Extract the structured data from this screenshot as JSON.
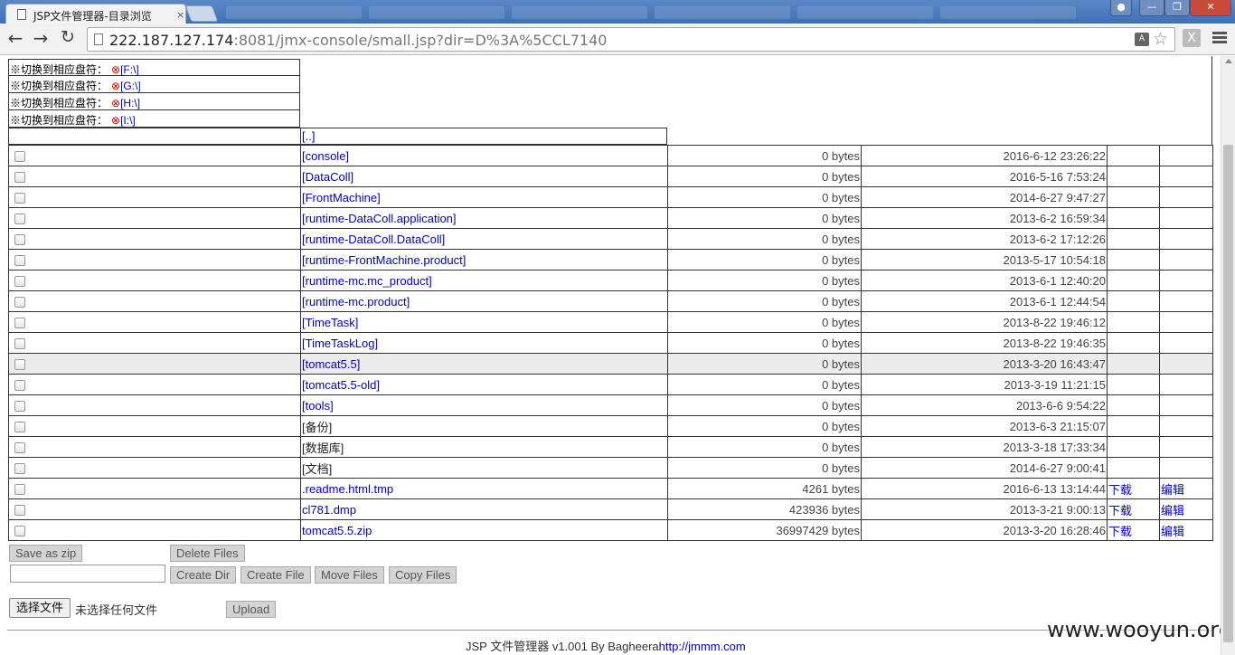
{
  "browser": {
    "tab_title": "JSP文件管理器-目录浏览",
    "tab_close": "×",
    "url_host": "222.187.127.174",
    "url_rest": ":8081/jmx-console/small.jsp?dir=D%3A%5CCL7140",
    "ext_label": "X"
  },
  "drives": [
    {
      "label": "※切换到相应盘符：",
      "link": "[F:\\]"
    },
    {
      "label": "※切换到相应盘符：",
      "link": "[G:\\]"
    },
    {
      "label": "※切换到相应盘符：",
      "link": "[H:\\]"
    },
    {
      "label": "※切换到相应盘符：",
      "link": "[I:\\]"
    }
  ],
  "parent_link": "[..]",
  "files": [
    {
      "name": "[console]",
      "size": "0 bytes",
      "date": "2016-6-12 23:26:22",
      "dl": "",
      "edit": ""
    },
    {
      "name": "[DataColl]",
      "size": "0 bytes",
      "date": "2016-5-16 7:53:24",
      "dl": "",
      "edit": ""
    },
    {
      "name": "[FrontMachine]",
      "size": "0 bytes",
      "date": "2014-6-27 9:47:27",
      "dl": "",
      "edit": ""
    },
    {
      "name": "[runtime-DataColl.application]",
      "size": "0 bytes",
      "date": "2013-6-2 16:59:34",
      "dl": "",
      "edit": ""
    },
    {
      "name": "[runtime-DataColl.DataColl]",
      "size": "0 bytes",
      "date": "2013-6-2 17:12:26",
      "dl": "",
      "edit": ""
    },
    {
      "name": "[runtime-FrontMachine.product]",
      "size": "0 bytes",
      "date": "2013-5-17 10:54:18",
      "dl": "",
      "edit": ""
    },
    {
      "name": "[runtime-mc.mc_product]",
      "size": "0 bytes",
      "date": "2013-6-1 12:40:20",
      "dl": "",
      "edit": ""
    },
    {
      "name": "[runtime-mc.product]",
      "size": "0 bytes",
      "date": "2013-6-1 12:44:54",
      "dl": "",
      "edit": ""
    },
    {
      "name": "[TimeTask]",
      "size": "0 bytes",
      "date": "2013-8-22 19:46:12",
      "dl": "",
      "edit": ""
    },
    {
      "name": "[TimeTaskLog]",
      "size": "0 bytes",
      "date": "2013-8-22 19:46:35",
      "dl": "",
      "edit": ""
    },
    {
      "name": "[tomcat5.5]",
      "size": "0 bytes",
      "date": "2013-3-20 16:43:47",
      "dl": "",
      "edit": ""
    },
    {
      "name": "[tomcat5.5-old]",
      "size": "0 bytes",
      "date": "2013-3-19 11:21:15",
      "dl": "",
      "edit": ""
    },
    {
      "name": "[tools]",
      "size": "0 bytes",
      "date": "2013-6-6 9:54:22",
      "dl": "",
      "edit": ""
    },
    {
      "name": "[备份]",
      "size": "0 bytes",
      "date": "2013-6-3 21:15:07",
      "dl": "",
      "edit": ""
    },
    {
      "name": "[数据库]",
      "size": "0 bytes",
      "date": "2013-3-18 17:33:34",
      "dl": "",
      "edit": ""
    },
    {
      "name": "[文档]",
      "size": "0 bytes",
      "date": "2014-6-27 9:00:41",
      "dl": "",
      "edit": ""
    },
    {
      "name": ".readme.html.tmp",
      "size": "4261 bytes",
      "date": "2016-6-13 13:14:44",
      "dl": "下载",
      "edit": "编辑"
    },
    {
      "name": "cl781.dmp",
      "size": "423936 bytes",
      "date": "2013-3-21 9:00:13",
      "dl": "下载",
      "edit": "编辑"
    },
    {
      "name": "tomcat5.5.zip",
      "size": "36997429 bytes",
      "date": "2013-3-20 16:28:46",
      "dl": "下载",
      "edit": "编辑"
    }
  ],
  "buttons": {
    "save_zip": "Save as zip",
    "delete_files": "Delete Files",
    "create_dir": "Create Dir",
    "create_file": "Create File",
    "move_files": "Move Files",
    "copy_files": "Copy Files",
    "choose_file": "选择文件",
    "no_file": "未选择任何文件",
    "upload": "Upload"
  },
  "footer": {
    "text": "JSP 文件管理器 v1.001 By Bagheera",
    "link": "http://jmmm.com"
  },
  "watermark": "www.wooyun.org"
}
